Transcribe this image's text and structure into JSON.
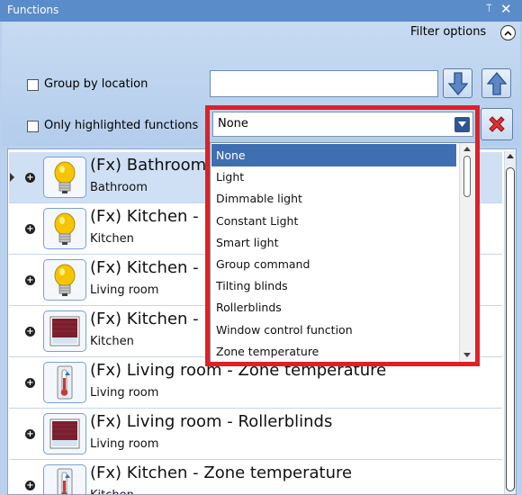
{
  "window": {
    "title": "Functions",
    "pin_glyph": "⍡",
    "close_glyph": "✕"
  },
  "filters": {
    "filter_options_label": "Filter options",
    "group_by_location_label": "Group by location",
    "only_highlighted_label": "Only highlighted functions",
    "search_value": "",
    "selected_type": "None"
  },
  "dropdown": {
    "options": [
      "None",
      "Light",
      "Dimmable light",
      "Constant Light",
      "Smart light",
      "Group command",
      "Tilting blinds",
      "Rollerblinds",
      "Window control function",
      "Zone temperature"
    ],
    "highlighted_index": 0
  },
  "functions": [
    {
      "name": "(Fx) Bathroom",
      "location": "Bathroom",
      "icon": "bulb-icon",
      "selected": true
    },
    {
      "name": "(Fx) Kitchen -",
      "location": "Kitchen",
      "icon": "bulb-icon",
      "selected": false
    },
    {
      "name": "(Fx) Kitchen -",
      "location": "Living room",
      "icon": "bulb-icon",
      "selected": false
    },
    {
      "name": "(Fx) Kitchen -",
      "location": "Kitchen",
      "icon": "rollerblind-icon",
      "selected": false
    },
    {
      "name": "(Fx) Living room - Zone temperature",
      "location": "Living room",
      "icon": "thermometer-icon",
      "selected": false
    },
    {
      "name": "(Fx) Living room - Rollerblinds",
      "location": "Living room",
      "icon": "rollerblind-icon",
      "selected": false
    },
    {
      "name": "(Fx) Kitchen - Zone temperature",
      "location": "Kitchen",
      "icon": "thermometer-icon",
      "selected": false
    }
  ],
  "colors": {
    "titlebar": "#5a8cc9",
    "panel": "#b9d1ee",
    "highlight": "#3f6fb0",
    "red_frame": "#e01f26"
  }
}
